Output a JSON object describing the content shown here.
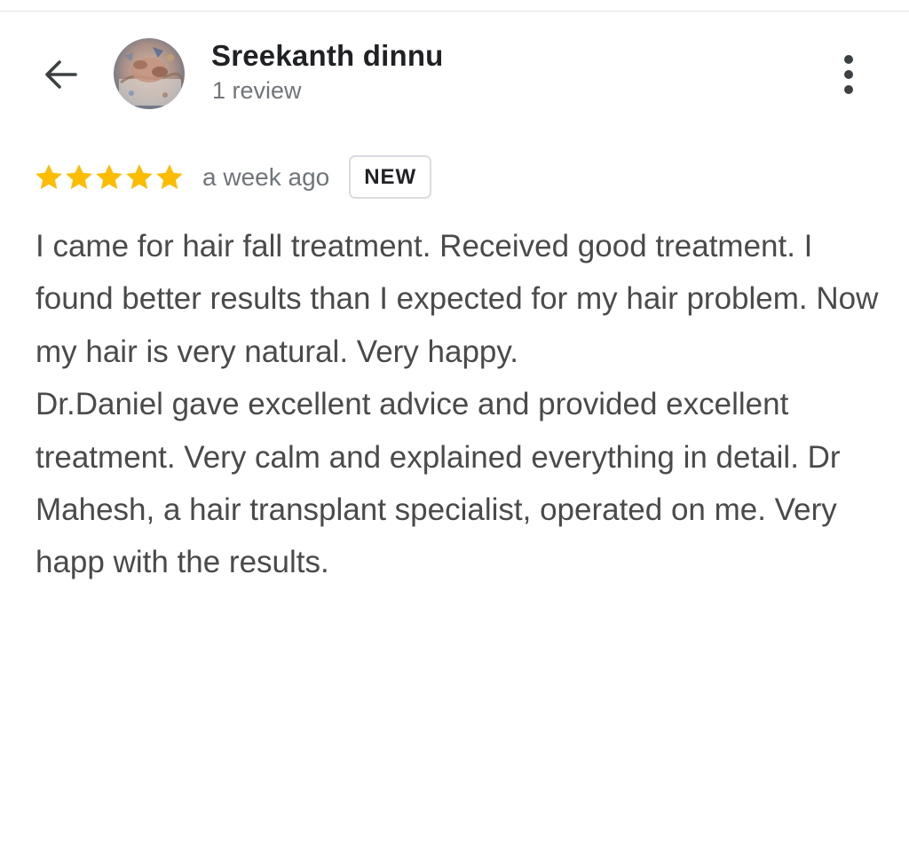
{
  "header": {
    "back_icon": "arrow-left-icon",
    "more_icon": "more-vert-icon"
  },
  "author": {
    "name": "Sreekanth dinnu",
    "review_count": "1 review",
    "avatar": "profile-photo"
  },
  "review": {
    "rating": 5,
    "rating_max": 5,
    "time_ago": "a week ago",
    "badge": "NEW",
    "paragraphs": [
      "I came for hair fall treatment. Received good treatment. I found better results than I expected for my hair problem. Now my hair is very natural. Very happy.",
      "Dr.Daniel gave excellent advice and provided excellent treatment. Very calm and explained everything in detail. Dr Mahesh, a hair transplant specialist, operated on me. Very happ with the results."
    ]
  },
  "colors": {
    "star": "#fbbc04",
    "text": "#4a4a4a",
    "secondary_text": "#70757a",
    "badge_border": "#dadce0"
  }
}
